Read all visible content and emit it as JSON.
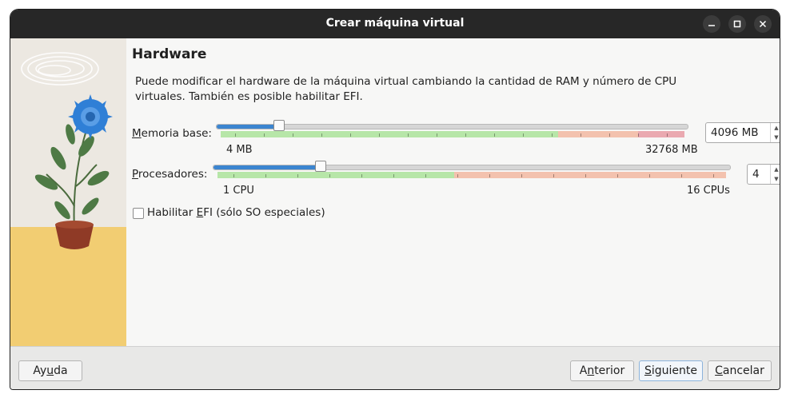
{
  "window": {
    "title": "Crear máquina virtual"
  },
  "titlebar_buttons": {
    "minimize": "minimize-icon",
    "maximize": "maximize-icon",
    "close": "close-icon"
  },
  "page": {
    "heading": "Hardware",
    "description": "Puede modificar el hardware de la máquina virtual cambiando la cantidad de RAM y número de CPU virtuales. También es posible habilitar EFI."
  },
  "memory": {
    "label_mnemonic": "M",
    "label_rest": "emoria base:",
    "min_label": "4 MB",
    "max_label": "32768 MB",
    "value": "4096 MB",
    "slider_fraction": 0.125
  },
  "processors": {
    "label_mnemonic": "P",
    "label_rest": "rocesadores:",
    "min_label": "1 CPU",
    "max_label": "16 CPUs",
    "value": "4",
    "slider_fraction": 0.2
  },
  "efi": {
    "label_prefix": "Habilitar ",
    "label_mnemonic": "E",
    "label_rest": "FI (sólo SO especiales)",
    "checked": false
  },
  "buttons": {
    "help_prefix": "Ay",
    "help_mnemonic": "u",
    "help_rest": "da",
    "back_prefix": "A",
    "back_mnemonic": "n",
    "back_rest": "terior",
    "next_mnemonic": "S",
    "next_rest": "iguiente",
    "cancel_mnemonic": "C",
    "cancel_rest": "ancelar"
  },
  "colors": {
    "slider_fill": "#3b85d0",
    "zone_ok": "#b7e6a8",
    "zone_warn": "#f3c2ae",
    "zone_bad": "#eaa9b0",
    "titlebar": "#272727"
  }
}
